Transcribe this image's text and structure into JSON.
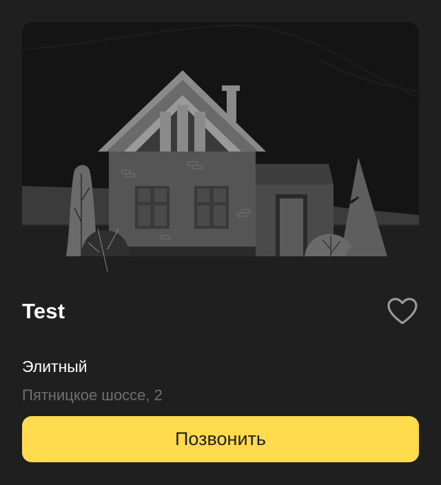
{
  "listing": {
    "image_icon": "house-illustration",
    "title": "Test",
    "favorite_icon": "heart-outline-icon",
    "category": "Элитный",
    "address": "Пятницкое шоссе, 2",
    "call_button_label": "Позвонить"
  },
  "colors": {
    "background": "#1f1f1f",
    "call_button": "#ffdb4d",
    "address_text": "#6f6f6f"
  }
}
